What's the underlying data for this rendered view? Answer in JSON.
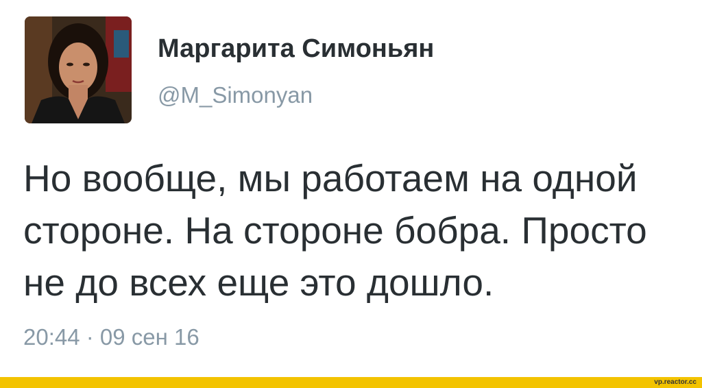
{
  "tweet": {
    "display_name": "Маргарита Симоньян",
    "handle": "@M_Simonyan",
    "text_lines": [
      "Но вообще, мы работаем на одной",
      "стороне. На стороне бобра. Просто",
      "не до всех еще это дошло."
    ],
    "timestamp": "20:44 · 09 сен 16"
  },
  "footer": {
    "watermark": "vp.reactor.cc",
    "bar_color": "#f3c300"
  },
  "colors": {
    "name": "#292f33",
    "secondary": "#8899a6"
  }
}
